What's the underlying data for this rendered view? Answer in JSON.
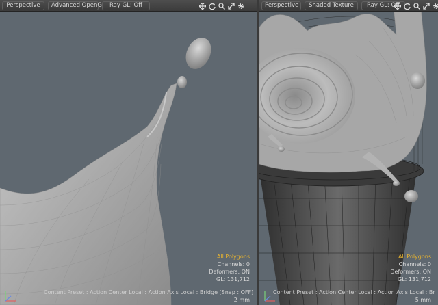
{
  "left_viewport": {
    "view_mode": "Perspective",
    "render_mode": "Advanced OpenGL",
    "ray_gl": "Ray GL: Off",
    "selection_mode": "All Polygons",
    "channels": "Channels: 0",
    "deformers": "Deformers: ON",
    "gl_count": "GL: 131,712",
    "content_preset": "Content Preset : Action Center Local : Action Axis Local : Bridge  [Snap : OFF]",
    "scale": "2 mm"
  },
  "right_viewport": {
    "view_mode": "Perspective",
    "render_mode": "Shaded Texture",
    "ray_gl": "Ray GL: Off",
    "selection_mode": "All Polygons",
    "channels": "Channels: 0",
    "deformers": "Deformers: ON",
    "gl_count": "GL: 131,712",
    "content_preset": "Content Preset : Action Center Local : Action Axis Local : Bridge  [Snap : OFF]",
    "scale": "5 mm"
  },
  "colors": {
    "viewport_bg": "#5f6870",
    "toolbar_bg": "#3d3d3d",
    "selection_highlight": "#e8b430"
  },
  "icons": [
    "move-icon",
    "rotate-icon",
    "zoom-icon",
    "maximize-icon",
    "gear-icon"
  ]
}
